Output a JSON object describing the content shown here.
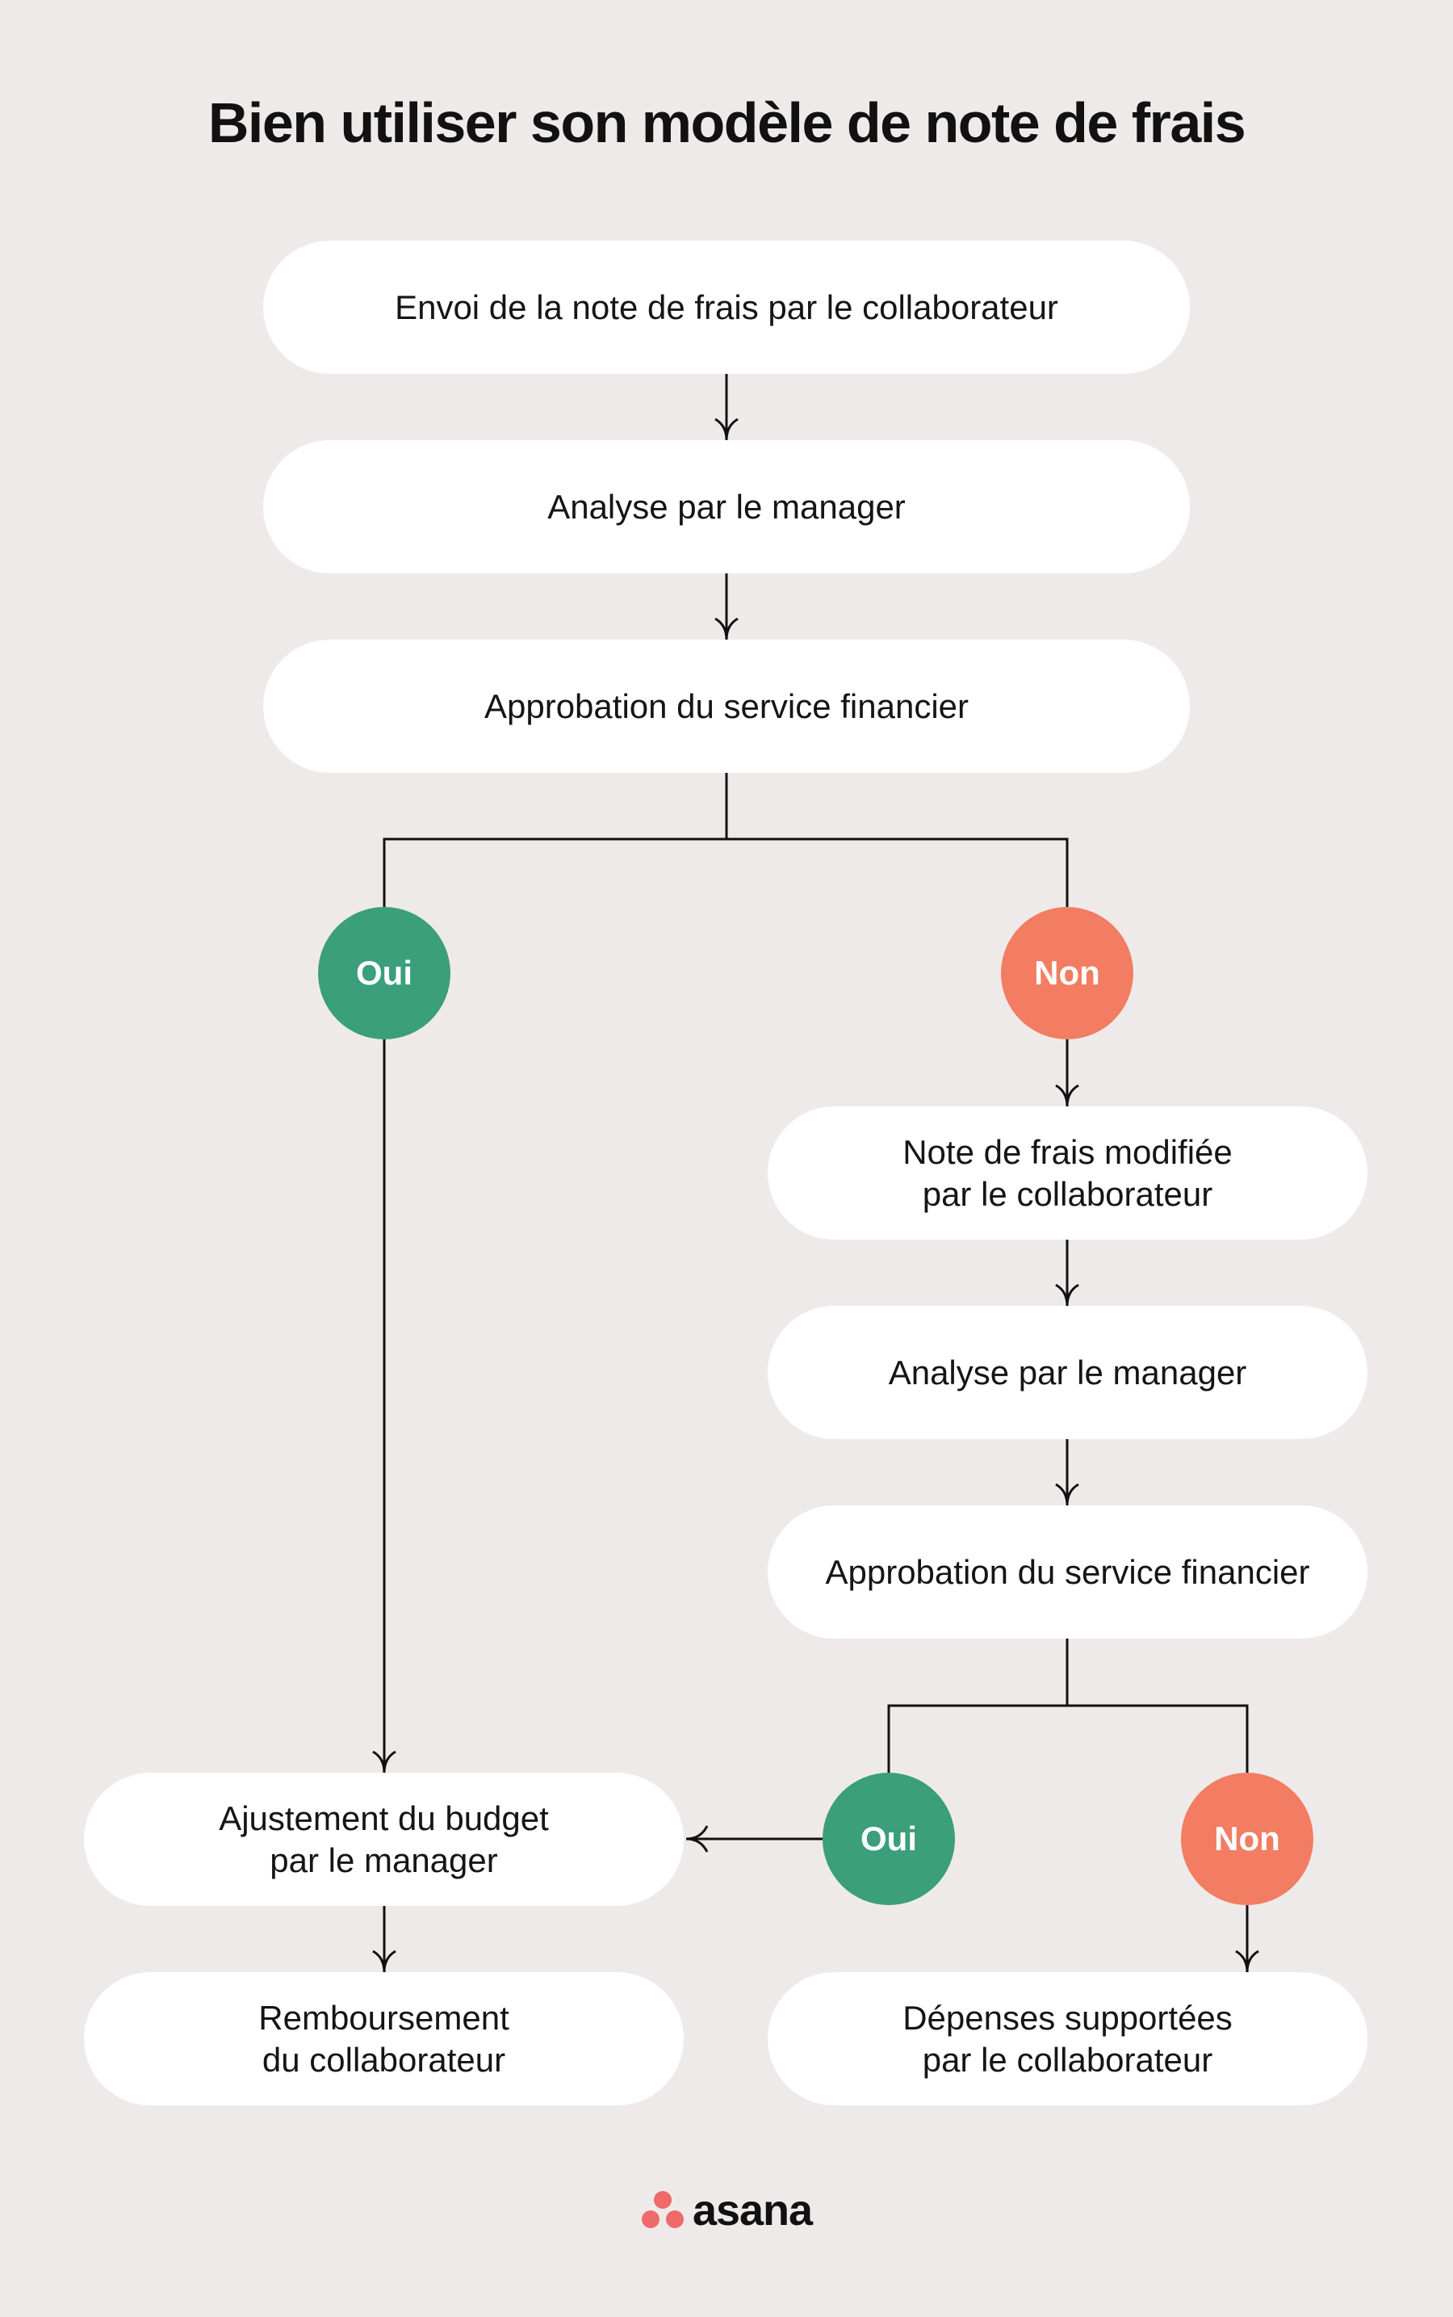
{
  "title": "Bien utiliser son modèle de note de frais",
  "colors": {
    "background": "#efeaea",
    "box": "#ffffff",
    "oui": "#3a9f7a",
    "non": "#f27d62",
    "line": "#111111",
    "logo_dots": "#f06a6a"
  },
  "steps": {
    "s1": "Envoi de la note de frais par le collaborateur",
    "s2": "Analyse par le manager",
    "s3": "Approbation du service financier",
    "s4": "Note de frais modifiée\npar le collaborateur",
    "s5": "Analyse par le manager",
    "s6": "Approbation du service financier",
    "s7": "Ajustement du budget\npar le manager",
    "s8": "Remboursement\ndu collaborateur",
    "s9": "Dépenses supportées\npar le collaborateur"
  },
  "decisions": {
    "oui1": "Oui",
    "non1": "Non",
    "oui2": "Oui",
    "non2": "Non"
  },
  "edges": [
    {
      "from": "s1",
      "to": "s2"
    },
    {
      "from": "s2",
      "to": "s3"
    },
    {
      "from": "s3",
      "to": "oui1"
    },
    {
      "from": "s3",
      "to": "non1"
    },
    {
      "from": "oui1",
      "to": "s7"
    },
    {
      "from": "non1",
      "to": "s4"
    },
    {
      "from": "s4",
      "to": "s5"
    },
    {
      "from": "s5",
      "to": "s6"
    },
    {
      "from": "s6",
      "to": "oui2"
    },
    {
      "from": "s6",
      "to": "non2"
    },
    {
      "from": "oui2",
      "to": "s7"
    },
    {
      "from": "non2",
      "to": "s9"
    },
    {
      "from": "s7",
      "to": "s8"
    }
  ],
  "logo": {
    "text": "asana",
    "icon": "asana-dots-icon"
  }
}
